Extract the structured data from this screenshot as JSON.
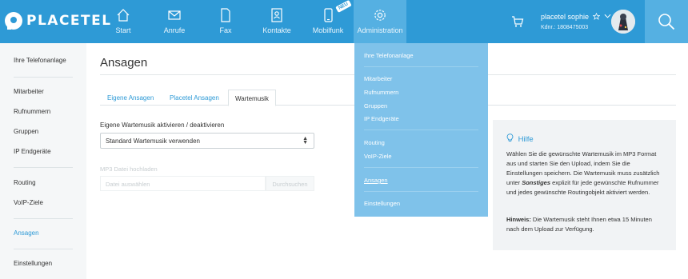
{
  "brand": {
    "name": "PLACETEL"
  },
  "nav": {
    "items": [
      {
        "label": "Start"
      },
      {
        "label": "Anrufe"
      },
      {
        "label": "Fax"
      },
      {
        "label": "Kontakte"
      },
      {
        "label": "Mobilfunk"
      },
      {
        "label": "Administration"
      }
    ],
    "badge": "NEU"
  },
  "user": {
    "name": "placetel sophie",
    "kdnr": "Kdnr.: 1808475003"
  },
  "sidebar": {
    "items": [
      {
        "label": "Ihre Telefonanlage"
      },
      {
        "label": "Mitarbeiter"
      },
      {
        "label": "Rufnummern"
      },
      {
        "label": "Gruppen"
      },
      {
        "label": "IP Endgeräte"
      },
      {
        "label": "Routing"
      },
      {
        "label": "VoIP-Ziele"
      },
      {
        "label": "Ansagen"
      },
      {
        "label": "Einstellungen"
      }
    ]
  },
  "main": {
    "title": "Ansagen",
    "tabs": [
      {
        "label": "Eigene Ansagen"
      },
      {
        "label": "Placetel Ansagen"
      },
      {
        "label": "Wartemusik"
      }
    ],
    "toggle_label": "Eigene Wartemusik aktivieren / deaktivieren",
    "select_value": "Standard Wartemusik verwenden",
    "upload_label": "MP3 Datei hochladen",
    "upload_placeholder": "Datei auswählen",
    "upload_button": "Durchsuchen"
  },
  "help": {
    "title": "Hilfe",
    "text_before": "Wählen Sie die gewünschte Wartemusik im MP3 Format aus und starten Sie den Upload, indem Sie die Einstellungen speichern. Die Wartemusik muss zusätzlich unter ",
    "text_emph": "Sonstiges",
    "text_after": " explizit für jede gewünschte Rufnummer und jedes gewünschte Routingobjekt aktiviert werden.",
    "hint_label": "Hinweis:",
    "hint_text": " Die Wartemusik steht Ihnen etwa 15 Minuten nach dem Upload zur Verfügung."
  },
  "dropdown": {
    "items": [
      {
        "label": "Ihre Telefonanlage"
      },
      {
        "label": "Mitarbeiter"
      },
      {
        "label": "Rufnummern"
      },
      {
        "label": "Gruppen"
      },
      {
        "label": "IP Endgeräte"
      },
      {
        "label": "Routing"
      },
      {
        "label": "VoIP-Ziele"
      },
      {
        "label": "Ansagen"
      },
      {
        "label": "Einstellungen"
      }
    ]
  },
  "colors": {
    "primary": "#2e9ad6",
    "nav_active": "#55b0e2",
    "dropdown_bg": "#7fc2ea",
    "sidebar_bg": "#f5f7f8",
    "help_bg": "#f1f3f5"
  },
  "icons": [
    "home-icon",
    "mail-icon",
    "fax-icon",
    "contacts-icon",
    "mobile-icon",
    "gear-icon",
    "cart-icon",
    "star-icon",
    "chevron-down-icon",
    "search-icon",
    "lightbulb-icon"
  ]
}
